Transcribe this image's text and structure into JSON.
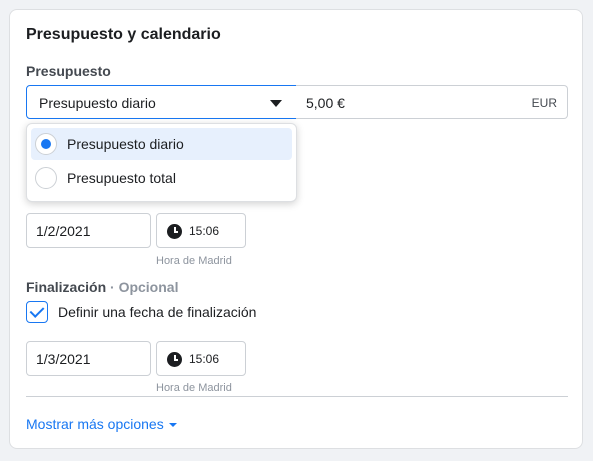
{
  "section": {
    "title": "Presupuesto y calendario"
  },
  "budget": {
    "label": "Presupuesto",
    "type_selected": "Presupuesto diario",
    "amount": "5,00 €",
    "currency": "EUR",
    "options": [
      {
        "label": "Presupuesto diario",
        "selected": true
      },
      {
        "label": "Presupuesto total",
        "selected": false
      }
    ]
  },
  "start": {
    "date": "1/2/2021",
    "time": "15:06",
    "timezone": "Hora de Madrid"
  },
  "end": {
    "label": "Finalización",
    "optional": "· Opcional",
    "checkbox_label": "Definir una fecha de finalización",
    "checked": true,
    "date": "1/3/2021",
    "time": "15:06",
    "timezone": "Hora de Madrid"
  },
  "more_options": "Mostrar más opciones",
  "colors": {
    "accent": "#1877f2",
    "selected_bg": "#e7f0fd"
  },
  "icons": [
    "chevron-down-icon",
    "clock-icon",
    "checkmark-icon",
    "radio-icon"
  ]
}
